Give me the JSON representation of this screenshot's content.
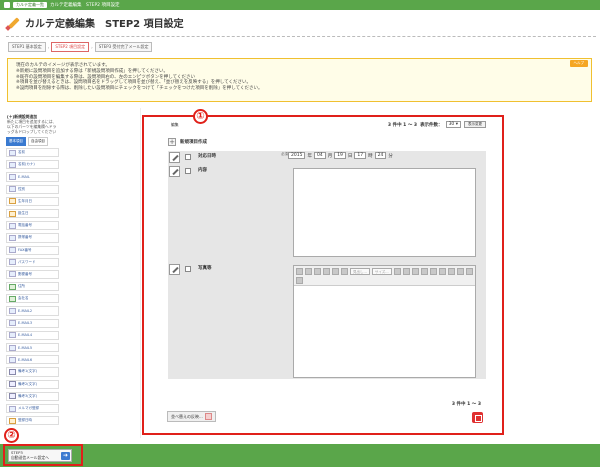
{
  "topbar": {
    "crumbs": [
      "カルテ定義一覧"
    ],
    "current": "カルテ定義編集　STEP2 項目設定"
  },
  "page": {
    "title": "カルテ定義編集　STEP2 項目設定"
  },
  "steps": [
    "STEP1 基本設定",
    "STEP2 項目設定",
    "STEP3 受付完了メール設定"
  ],
  "notice": {
    "help_label": "ヘルプ",
    "lines": [
      "現在のカルテのイメージが表示されています。",
      "※新規に設問項目を追加する際は「新規設問項目作成」を押してください。",
      "※既存の設問項目を編集する際は、設問項目右の、左のエンピツボタンを押してください",
      "※項目を並び替えるときは、設問項目名をドラッグして項目を並び替え、「並び替えを反映する」を押してください。",
      "※設問項目を削除する際は、削除したい設問項目にチェックをつけて「チェックをつけた項目を削除」を押してください。"
    ]
  },
  "sidebar": {
    "info_title": "[＋]新規設問追加",
    "info_text": "新たに項目を追加するには、以下のパーツを編集欄へドラッグ＆ドロップしてください",
    "tabs": [
      "基本項目",
      "自由項目"
    ],
    "items": [
      {
        "label": "名前",
        "icon": "person-icon"
      },
      {
        "label": "名前(カナ)",
        "icon": "person-icon"
      },
      {
        "label": "E-MAIL",
        "icon": "mail-icon"
      },
      {
        "label": "性別",
        "icon": "gender-icon"
      },
      {
        "label": "生年月日",
        "icon": "date-icon"
      },
      {
        "label": "誕生日",
        "icon": "date-icon"
      },
      {
        "label": "電話番号",
        "icon": "phone-icon"
      },
      {
        "label": "携帯番号",
        "icon": "phone-icon"
      },
      {
        "label": "FAX番号",
        "icon": "fax-icon"
      },
      {
        "label": "パスワード",
        "icon": "lock-icon"
      },
      {
        "label": "郵便番号",
        "icon": "post-icon"
      },
      {
        "label": "住所",
        "icon": "home-icon"
      },
      {
        "label": "会社名",
        "icon": "building-icon"
      },
      {
        "label": "E-MAIL2",
        "icon": "mail-icon"
      },
      {
        "label": "E-MAIL3",
        "icon": "mail-icon"
      },
      {
        "label": "E-MAIL4",
        "icon": "mail-icon"
      },
      {
        "label": "E-MAIL5",
        "icon": "mail-icon"
      },
      {
        "label": "E-MAIL6",
        "icon": "mail-icon"
      },
      {
        "label": "備考1(文字)",
        "icon": "note-icon"
      },
      {
        "label": "備考2(文字)",
        "icon": "note-icon"
      },
      {
        "label": "備考3(文字)",
        "icon": "note-icon"
      },
      {
        "label": "メルマガ登録",
        "icon": "mail-icon"
      },
      {
        "label": "登録日時",
        "icon": "date-icon"
      }
    ]
  },
  "main": {
    "edit_label": "編集",
    "paging": "3 件中 1 ～ 3",
    "per_page_label": "表示件数：",
    "per_page_value": "30",
    "per_page_button": "表示変更",
    "add_label": "新規項目作成",
    "required_mark": "必須",
    "rows": [
      {
        "label": "対応日時",
        "type": "date"
      },
      {
        "label": "内容",
        "type": "textarea"
      },
      {
        "label": "写真等",
        "type": "editor"
      }
    ],
    "date": {
      "year": "2015",
      "year_unit": "年",
      "month": "04",
      "month_unit": "月",
      "day": "19",
      "day_unit": "日",
      "hour": "17",
      "hour_unit": "時",
      "minute": "24",
      "minute_unit": "分"
    },
    "editor": {
      "format_placeholder": "見出し...",
      "size_placeholder": "サイズ..."
    },
    "paging_bottom": "3 件中 1 ～ 3",
    "apply_label": "並べ替えの反映..."
  },
  "callouts": [
    "①",
    "②"
  ],
  "next_button": {
    "line1": "STEP3",
    "line2": "自動送信メール設定へ"
  }
}
